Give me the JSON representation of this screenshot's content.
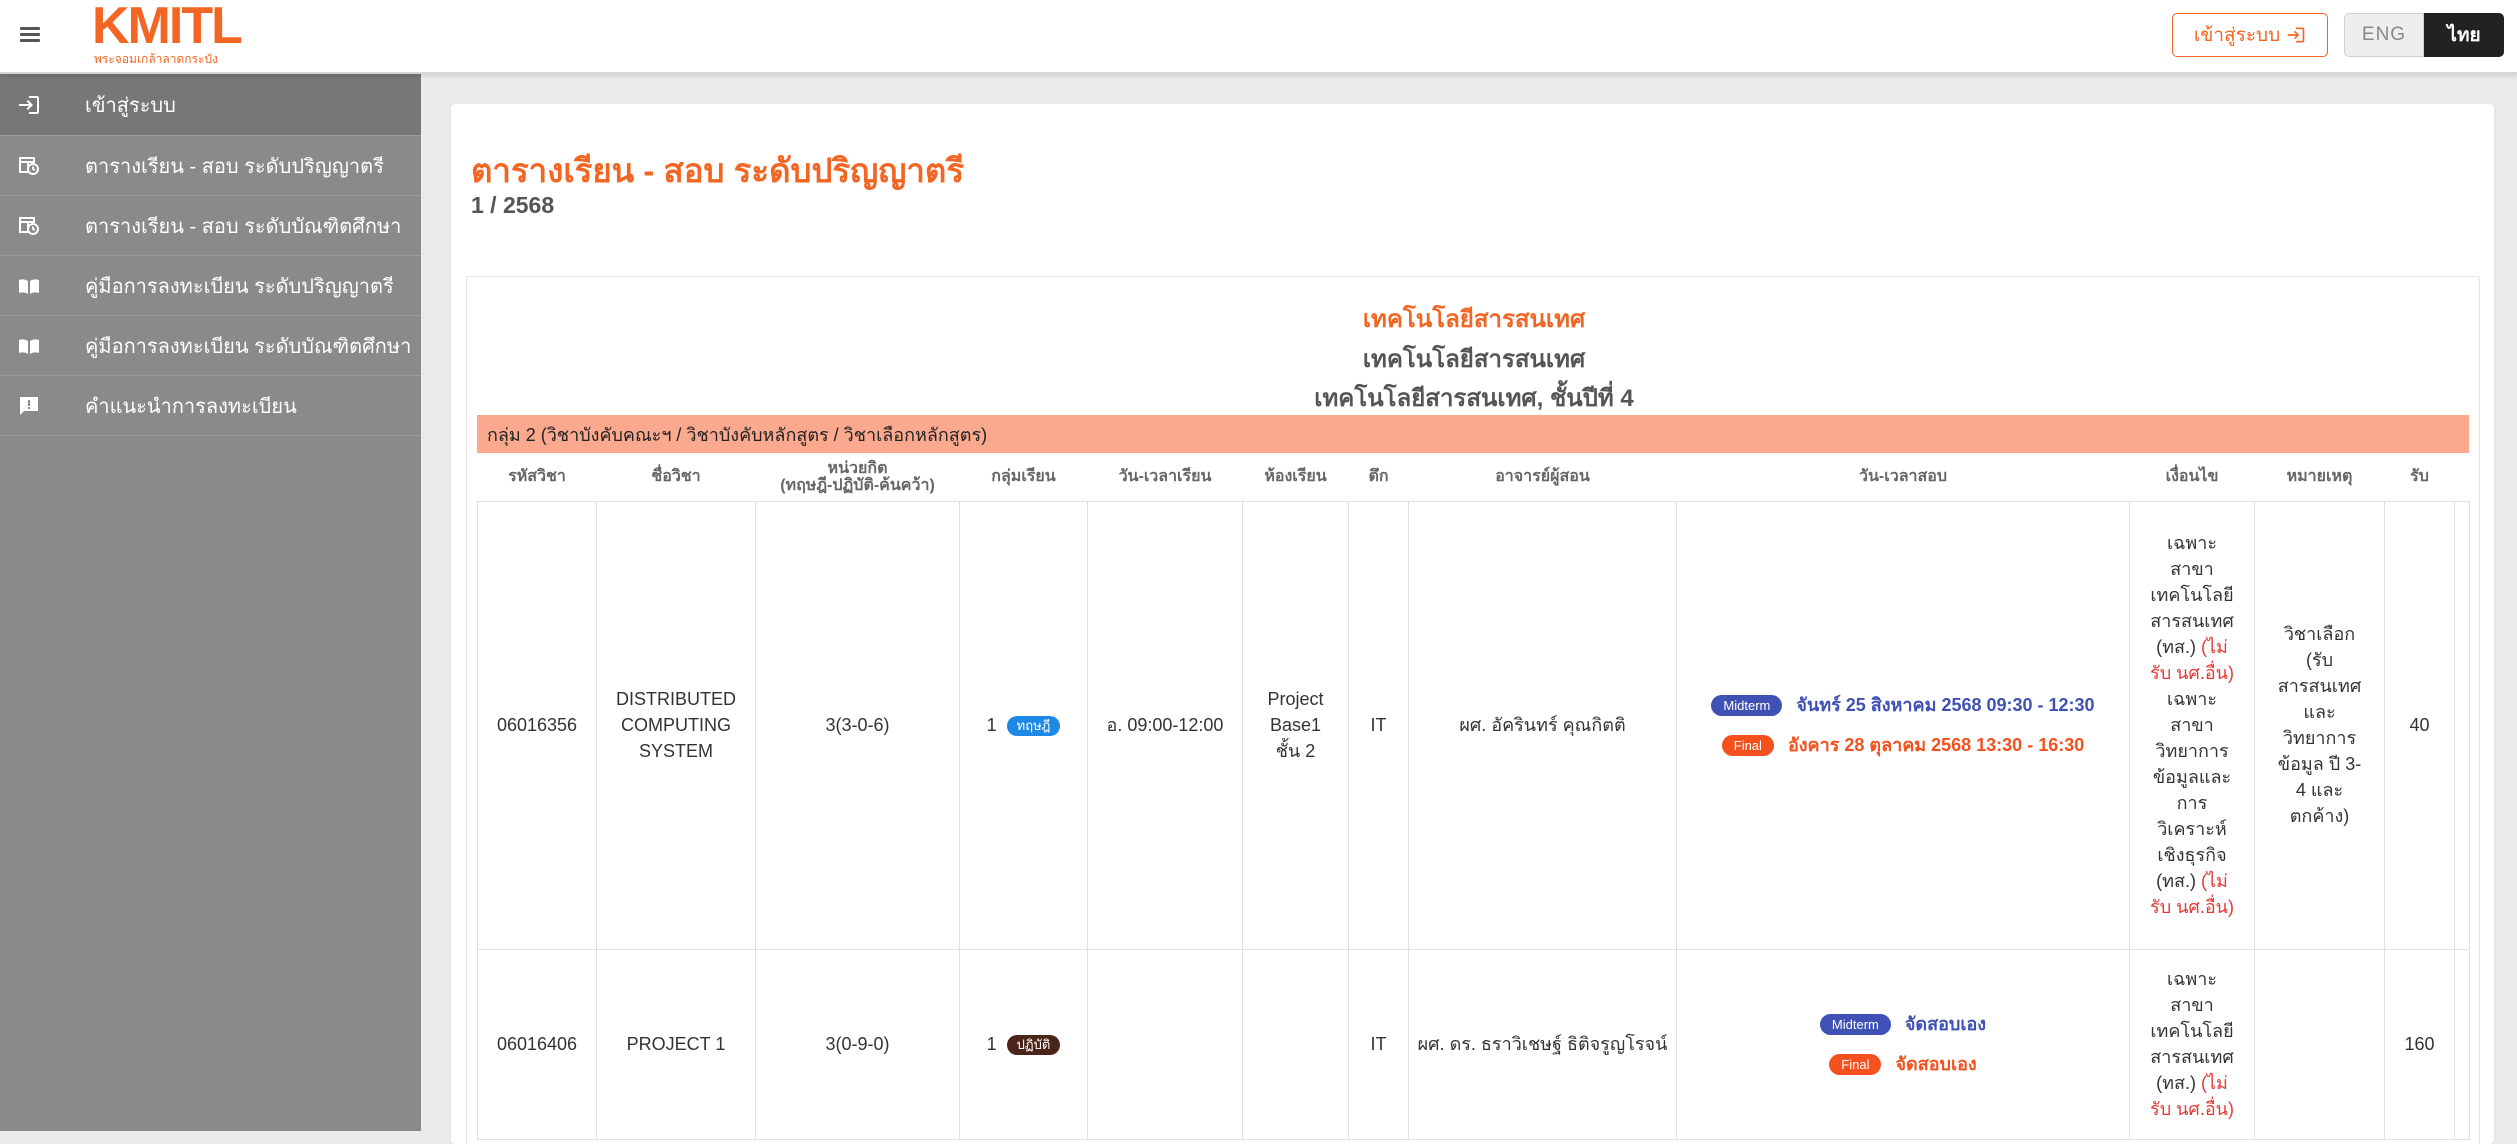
{
  "header": {
    "logo_text": "KMITL",
    "logo_subtitle": "พระจอมเกล้าลาดกระบัง",
    "login_label": "เข้าสู่ระบบ",
    "lang_eng": "ENG",
    "lang_thai": "ไทย"
  },
  "sidebar": {
    "items": [
      {
        "label": "เข้าสู่ระบบ",
        "icon": "login-icon"
      },
      {
        "label": "ตารางเรียน - สอบ ระดับปริญญาตรี",
        "icon": "calendar-clock-icon"
      },
      {
        "label": "ตารางเรียน - สอบ ระดับบัณฑิตศึกษา",
        "icon": "calendar-clock-icon"
      },
      {
        "label": "คู่มือการลงทะเบียน ระดับปริญญาตรี",
        "icon": "book-icon"
      },
      {
        "label": "คู่มือการลงทะเบียน ระดับบัณฑิตศึกษา",
        "icon": "book-icon"
      },
      {
        "label": "คำแนะนำการลงทะเบียน",
        "icon": "feedback-icon"
      }
    ]
  },
  "main": {
    "title": "ตารางเรียน - สอบ ระดับปริญญาตรี",
    "term": "1 / 2568",
    "faculty": "เทคโนโลยีสารสนเทศ",
    "department": "เทคโนโลยีสารสนเทศ",
    "program": "เทคโนโลยีสารสนเทศ, ชั้นปีที่ 4",
    "group_label": "กลุ่ม 2 (วิชาบังคับคณะฯ / วิชาบังคับหลักสูตร / วิชาเลือกหลักสูตร)",
    "columns": {
      "code": "รหัสวิชา",
      "name": "ชื่อวิชา",
      "credit_line1": "หน่วยกิต",
      "credit_line2": "(ทฤษฎี-ปฏิบัติ-ค้นคว้า)",
      "section": "กลุ่มเรียน",
      "class_time": "วัน-เวลาเรียน",
      "room": "ห้องเรียน",
      "building": "ตึก",
      "instructor": "อาจารย์ผู้สอน",
      "exam_time": "วัน-เวลาสอบ",
      "condition": "เงื่อนไข",
      "remark": "หมายเหตุ",
      "capacity": "รับ"
    },
    "rows": [
      {
        "code": "06016356",
        "name": "DISTRIBUTED COMPUTING SYSTEM",
        "credit": "3(3-0-6)",
        "section": "1",
        "section_type": "ทฤษฎี",
        "class_time": "อ. 09:00-12:00",
        "room": "Project Base1 ชั้น 2",
        "building": "IT",
        "instructor": "ผศ. อัครินทร์ คุณกิตติ",
        "midterm_label": "Midterm",
        "midterm": "จันทร์ 25 สิงหาคม 2568 09:30 - 12:30",
        "final_label": "Final",
        "final": "อังคาร 28 ตุลาคม 2568 13:30 - 16:30",
        "cond1": "เฉพาะ สาขา เทคโนโลยี สารสนเทศ (ทส.)",
        "cond1_red": "(ไม่รับ นศ.อื่น)",
        "cond2": "เฉพาะ สาขา วิทยาการ ข้อมูลและ การ วิเคราะห์ เชิงธุรกิจ (ทส.)",
        "cond2_red": "(ไม่รับ นศ.อื่น)",
        "remark": "วิชาเลือก (รับ สารสนเทศ และ วิทยาการ ข้อมูล ปี 3- 4 และ ตกค้าง)",
        "capacity": "40"
      },
      {
        "code": "06016406",
        "name": "PROJECT 1",
        "credit": "3(0-9-0)",
        "section": "1",
        "section_type": "ปฏิบัติ",
        "class_time": "",
        "room": "",
        "building": "IT",
        "instructor": "ผศ. ดร. ธราวิเชษฐ์ ธิติจรูญโรจน์",
        "midterm_label": "Midterm",
        "midterm": "จัดสอบเอง",
        "final_label": "Final",
        "final": "จัดสอบเอง",
        "cond1": "เฉพาะ สาขา เทคโนโลยี สารสนเทศ (ทส.)",
        "cond1_red": "(ไม่รับ นศ.อื่น)",
        "remark": "",
        "capacity": "160"
      }
    ]
  },
  "colors": {
    "accent": "#f26522",
    "sidebar_bg": "#8a8a8a",
    "group_bar": "#fba98e",
    "midterm": "#3f51b5",
    "final": "#f4511e"
  }
}
